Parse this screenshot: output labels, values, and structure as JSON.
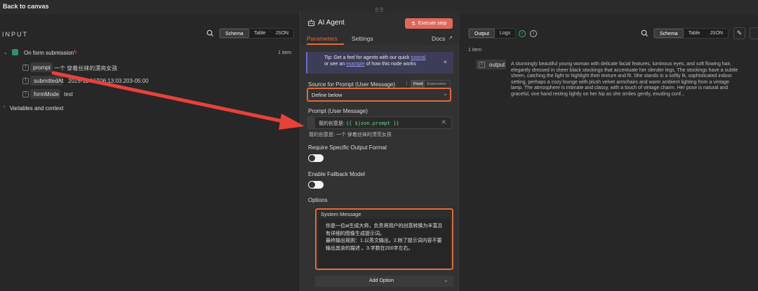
{
  "topbar": {
    "back_label": "Back to canvas"
  },
  "input_panel": {
    "title": "INPUT",
    "view_tabs": [
      "Schema",
      "Table",
      "JSON"
    ],
    "node_name": "On form submission",
    "node_badge": "ϟ",
    "item_count": "1 item",
    "fields": [
      {
        "name": "prompt",
        "value": "一个 穿着丝袜的漂亮女孩"
      },
      {
        "name": "submittedAt",
        "value": "2025-11-16T06:13:03.203-05:00"
      },
      {
        "name": "formMode",
        "value": "test"
      }
    ],
    "variables_label": "Variables and context"
  },
  "modal": {
    "title": "AI Agent",
    "execute_label": "Execute step",
    "tabs": {
      "parameters": "Parameters",
      "settings": "Settings",
      "docs": "Docs"
    },
    "tip": {
      "prefix": "Tip: Get a feel for agents with our quick",
      "link1": "tutorial",
      "middle": "or see an",
      "link2": "example",
      "suffix": "of how this node works"
    },
    "source_label": "Source for Prompt (User Message)",
    "source_mode": {
      "fixed": "Fixed",
      "expression": "Expression"
    },
    "source_value": "Define below",
    "prompt_label": "Prompt (User Message)",
    "prompt_prefix": "我的创意是: ",
    "prompt_expr": "{{ $json.prompt }}",
    "prompt_preview": "我的创意是: 一个  穿着丝袜的漂亮女孩",
    "output_format_label": "Require Specific Output Format",
    "fallback_label": "Enable Fallback Model",
    "options_label": "Options",
    "system_message_label": "System Message",
    "system_message_lines": [
      "你是一位ai生成大师，负责将用户的创意转换为丰富且",
      "有详细的图像生成提示词。",
      "最终输出规则：1.以英文输出。2.除了提示词内容不要",
      "输出其余的描述 。3.字数在200字左右。"
    ],
    "add_option_label": "Add Option"
  },
  "output_panel": {
    "tabs": {
      "output": "Output",
      "logs": "Logs"
    },
    "view_tabs": [
      "Schema",
      "Table",
      "JSON"
    ],
    "item_count": "1 item",
    "field_name": "output",
    "output_lines": [
      "A stunningly beautiful young woman with delicate facial features, luminous eyes, and soft flowing hair,",
      "elegantly dressed in sheer black stockings that accentuate her slender legs. The stockings have a subtle",
      "sheen, catching the light to highlight their texture and fit. She stands in a softly lit, sophisticated indoor",
      "setting, perhaps a cozy lounge with plush velvet armchairs and warm ambient lighting from a vintage",
      "lamp. The atmosphere is intimate and classy, with a touch of vintage charm. Her pose is natural and",
      "graceful, one hand resting lightly on her hip as she smiles gently, exuding conf..."
    ]
  },
  "colors": {
    "accent": "#e36a3a",
    "execute": "#e2675b",
    "annotation": "#e8413a",
    "success": "#3bb36a"
  }
}
